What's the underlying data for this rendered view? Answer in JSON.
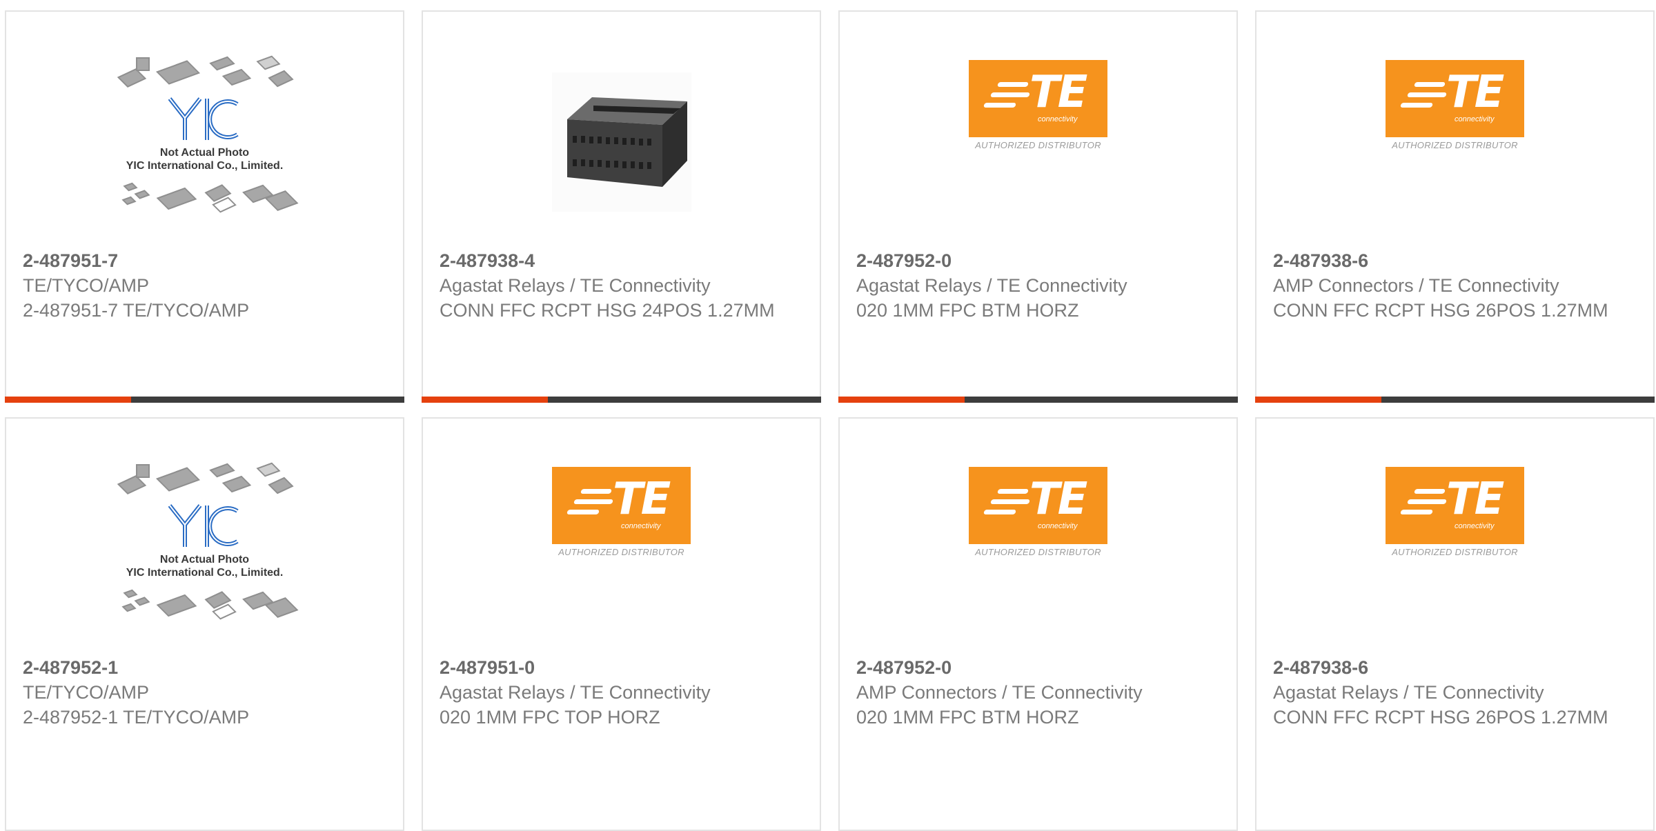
{
  "colors": {
    "bar_dark": "#3d3d3d",
    "bar_accent": "#e5410e",
    "te_orange": "#f6931d",
    "text": "#7a7a7a",
    "yic_blue": "#2a6cc4"
  },
  "cards": [
    {
      "part_number": "2-487951-7",
      "manufacturer": "TE/TYCO/AMP",
      "description": "2-487951-7 TE/TYCO/AMP",
      "image": "yic-placeholder",
      "image_caption_line1": "Not Actual Photo",
      "image_caption_line2": "YIC International Co., Limited."
    },
    {
      "part_number": "2-487938-4",
      "manufacturer": "Agastat Relays / TE Connectivity",
      "description": "CONN FFC RCPT HSG 24POS 1.27MM",
      "image": "connector-photo"
    },
    {
      "part_number": "2-487952-0",
      "manufacturer": "Agastat Relays / TE Connectivity",
      "description": "020 1MM FPC BTM HORZ",
      "image": "te-logo",
      "logo_text": "TE",
      "logo_sub": "connectivity",
      "logo_caption": "AUTHORIZED DISTRIBUTOR"
    },
    {
      "part_number": "2-487938-6",
      "manufacturer": "AMP Connectors / TE Connectivity",
      "description": "CONN FFC RCPT HSG 26POS 1.27MM",
      "image": "te-logo",
      "logo_text": "TE",
      "logo_sub": "connectivity",
      "logo_caption": "AUTHORIZED DISTRIBUTOR"
    },
    {
      "part_number": "2-487952-1",
      "manufacturer": "TE/TYCO/AMP",
      "description": "2-487952-1 TE/TYCO/AMP",
      "image": "yic-placeholder",
      "image_caption_line1": "Not Actual Photo",
      "image_caption_line2": "YIC International Co., Limited."
    },
    {
      "part_number": "2-487951-0",
      "manufacturer": "Agastat Relays / TE Connectivity",
      "description": "020 1MM FPC TOP HORZ",
      "image": "te-logo",
      "logo_text": "TE",
      "logo_sub": "connectivity",
      "logo_caption": "AUTHORIZED DISTRIBUTOR"
    },
    {
      "part_number": "2-487952-0",
      "manufacturer": "AMP Connectors / TE Connectivity",
      "description": "020 1MM FPC BTM HORZ",
      "image": "te-logo",
      "logo_text": "TE",
      "logo_sub": "connectivity",
      "logo_caption": "AUTHORIZED DISTRIBUTOR"
    },
    {
      "part_number": "2-487938-6",
      "manufacturer": "Agastat Relays / TE Connectivity",
      "description": "CONN FFC RCPT HSG 26POS 1.27MM",
      "image": "te-logo",
      "logo_text": "TE",
      "logo_sub": "connectivity",
      "logo_caption": "AUTHORIZED DISTRIBUTOR"
    }
  ]
}
